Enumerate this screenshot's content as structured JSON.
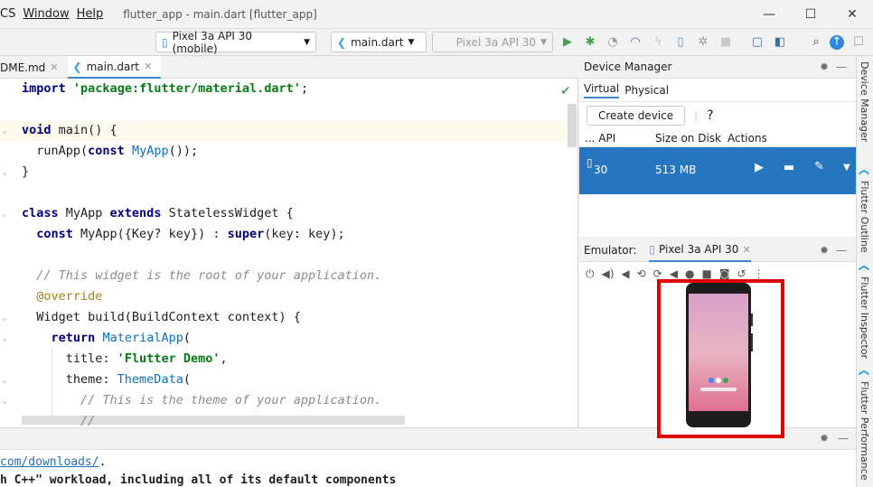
{
  "menu": [
    "CS",
    "Window",
    "Help"
  ],
  "window_title": "flutter_app - main.dart [flutter_app]",
  "window_controls": [
    "—",
    "☐",
    "✕"
  ],
  "toolbar": {
    "device_select": "Pixel 3a API 30 (mobile)",
    "config_select": "main.dart",
    "target_select": "Pixel 3a API 30"
  },
  "tabs": [
    "DME.md",
    "main.dart"
  ],
  "code": [
    {
      "n": 0,
      "html": "<span class='kw'>import</span> <span class='str'>'package:flutter/material.dart'</span>;"
    },
    {
      "n": 2,
      "html": "<span class='kw'>void</span> main() {"
    },
    {
      "n": 3,
      "html": "  runApp(<span class='kw'>const</span> <span class='cls'>MyApp</span>());"
    },
    {
      "n": 4,
      "html": "}"
    },
    {
      "n": 6,
      "html": "<span class='kw'>class</span> MyApp <span class='kw'>extends</span> StatelessWidget {"
    },
    {
      "n": 7,
      "html": "  <span class='kw'>const</span> MyApp({Key? key}) : <span class='kw'>super</span>(key: key);"
    },
    {
      "n": 9,
      "html": "  <span class='cmt'>// This widget is the root of your application.</span>"
    },
    {
      "n": 10,
      "html": "  <span class='ann'>@override</span>"
    },
    {
      "n": 11,
      "html": "  Widget build(BuildContext context) {"
    },
    {
      "n": 12,
      "html": "    <span class='kw'>return</span> <span class='cls'>MaterialApp</span>("
    },
    {
      "n": 13,
      "html": "      title: <span class='str'>'Flutter Demo'</span>,"
    },
    {
      "n": 14,
      "html": "      theme: <span class='cls'>ThemeData</span>("
    },
    {
      "n": 15,
      "html": "        <span class='cmt'>// This is the theme of your application.</span>"
    },
    {
      "n": 16,
      "html": "        <span class='cmt'>//</span>"
    }
  ],
  "bottom_output": {
    "line1_link": "com/downloads/",
    "line1_tail": ".",
    "line2": "h C++\" workload, including all of its default components"
  },
  "device_manager": {
    "title": "Device Manager",
    "subtabs": [
      "Virtual",
      "Physical"
    ],
    "create_button": "Create device",
    "help": "?",
    "columns": [
      "... API",
      "Size on Disk",
      "Actions"
    ],
    "device": {
      "api": "30",
      "size": "513 MB"
    }
  },
  "emulator": {
    "label": "Emulator:",
    "tab": "Pixel 3a API 30"
  },
  "right_strip": [
    "Device Manager",
    "Flutter Outline",
    "Flutter Inspector",
    "Flutter Performance"
  ]
}
